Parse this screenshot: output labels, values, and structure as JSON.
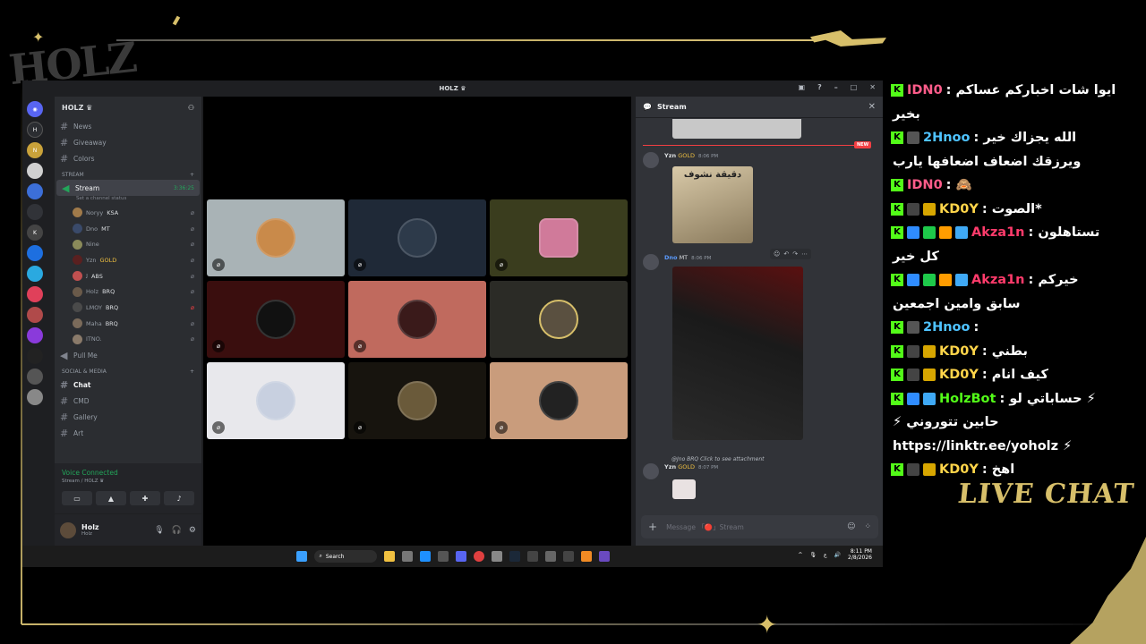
{
  "overlay": {
    "logo": "HOLZ",
    "live_chat_label": "LIVE CHAT"
  },
  "titlebar": {
    "title": "HOLZ ♛"
  },
  "sidebar": {
    "guild_name": "HOLZ ♛",
    "channels_top": [
      {
        "label": "News"
      },
      {
        "label": "Giveaway"
      },
      {
        "label": "Colors"
      }
    ],
    "category_stream": "STREAM",
    "stream_channel": "Stream",
    "stream_timer": "3:36:25",
    "stream_status": "Set a channel status",
    "voice_users": [
      {
        "name": "Noryy",
        "tag": "KSA"
      },
      {
        "name": "Dno",
        "tag": "MT"
      },
      {
        "name": "Nine",
        "tag": ""
      },
      {
        "name": "Yzn",
        "tag": "GOLD"
      },
      {
        "name": "ﻟ",
        "tag": "ABS"
      },
      {
        "name": "Holz",
        "tag": "BRQ"
      },
      {
        "name": "LMOY",
        "tag": "BRQ"
      },
      {
        "name": "Maha",
        "tag": "BRQ"
      },
      {
        "name": "ITNO.",
        "tag": ""
      }
    ],
    "pull_me": "Pull Me",
    "category_social": "SOCIAL & MEDIA",
    "channels_social": [
      {
        "label": "Chat"
      },
      {
        "label": "CMD"
      },
      {
        "label": "Gallery"
      },
      {
        "label": "Art"
      }
    ],
    "voice_connected": "Voice Connected",
    "voice_sub": "Stream / HOLZ ♛",
    "user_name": "Holz",
    "user_status": "Holz"
  },
  "chat": {
    "header": "Stream",
    "msg1_user": "Yzn",
    "msg1_tag": "GOLD",
    "msg1_time": "8:06 PM",
    "cat_caption": "دقيقة نشوف",
    "new_badge": "NEW",
    "msg2_user": "Dno",
    "msg2_tag": "MT",
    "msg2_time": "8:06 PM",
    "reply_text": "@Jno  BRQ  Click to see attachment",
    "msg3_user": "Yzn",
    "msg3_tag": "GOLD",
    "msg3_time": "8:07 PM",
    "composer_placeholder": "Message 「🔴」Stream"
  },
  "taskbar": {
    "search": "Search",
    "time": "8:11 PM",
    "date": "2/8/2026",
    "lang": "ع"
  },
  "overlay_chat": [
    {
      "user": "IDN0",
      "user_color": "#ff5c8a",
      "text": ": ايوا شات اخباركم عساكم",
      "cont": "بخير",
      "badges": []
    },
    {
      "user": "2Hnoo",
      "user_color": "#4fc3ff",
      "text": ": الله يجزاك خير",
      "cont": "ويرزقك اضعاف اضعافها يارب",
      "badges": [
        "#555"
      ]
    },
    {
      "user": "IDN0",
      "user_color": "#ff5c8a",
      "text": ": 🙈",
      "cont": "",
      "badges": []
    },
    {
      "user": "KD0Y",
      "user_color": "#ffd54a",
      "text": ": الصوت*",
      "cont": "",
      "badges": [
        "#444",
        "#d7a600"
      ]
    },
    {
      "user": "Akza1n",
      "user_color": "#ff3b6b",
      "text": ": تستاهلون",
      "cont": "كل خير",
      "badges": [
        "#2f8cff",
        "#1ec94a",
        "#ff9c00",
        "#3fa9f5"
      ]
    },
    {
      "user": "Akza1n",
      "user_color": "#ff3b6b",
      "text": ": خيركم",
      "cont": "سابق وامين اجمعين",
      "badges": [
        "#2f8cff",
        "#1ec94a",
        "#ff9c00",
        "#3fa9f5"
      ]
    },
    {
      "user": "2Hnoo",
      "user_color": "#4fc3ff",
      "text": ":",
      "cont": "",
      "badges": [
        "#555"
      ]
    },
    {
      "user": "KD0Y",
      "user_color": "#ffd54a",
      "text": ": بطني",
      "cont": "",
      "badges": [
        "#444",
        "#d7a600"
      ]
    },
    {
      "user": "KD0Y",
      "user_color": "#ffd54a",
      "text": ": كيف انام",
      "cont": "",
      "badges": [
        "#444",
        "#d7a600"
      ]
    },
    {
      "user": "HolzBot",
      "user_color": "#53fc18",
      "text": ": حساباتي لو ⚡",
      "cont": "⚡ حابين تتوروني",
      "badges": [
        "#2f8cff",
        "#3fa9f5"
      ]
    },
    {
      "user": "",
      "user_color": "#fff",
      "text": "",
      "cont": "https://linktr.ee/yoholz ⚡",
      "badges": [],
      "link_only": true
    },
    {
      "user": "KD0Y",
      "user_color": "#ffd54a",
      "text": ": اهخ",
      "cont": "",
      "badges": [
        "#444",
        "#d7a600"
      ]
    }
  ]
}
